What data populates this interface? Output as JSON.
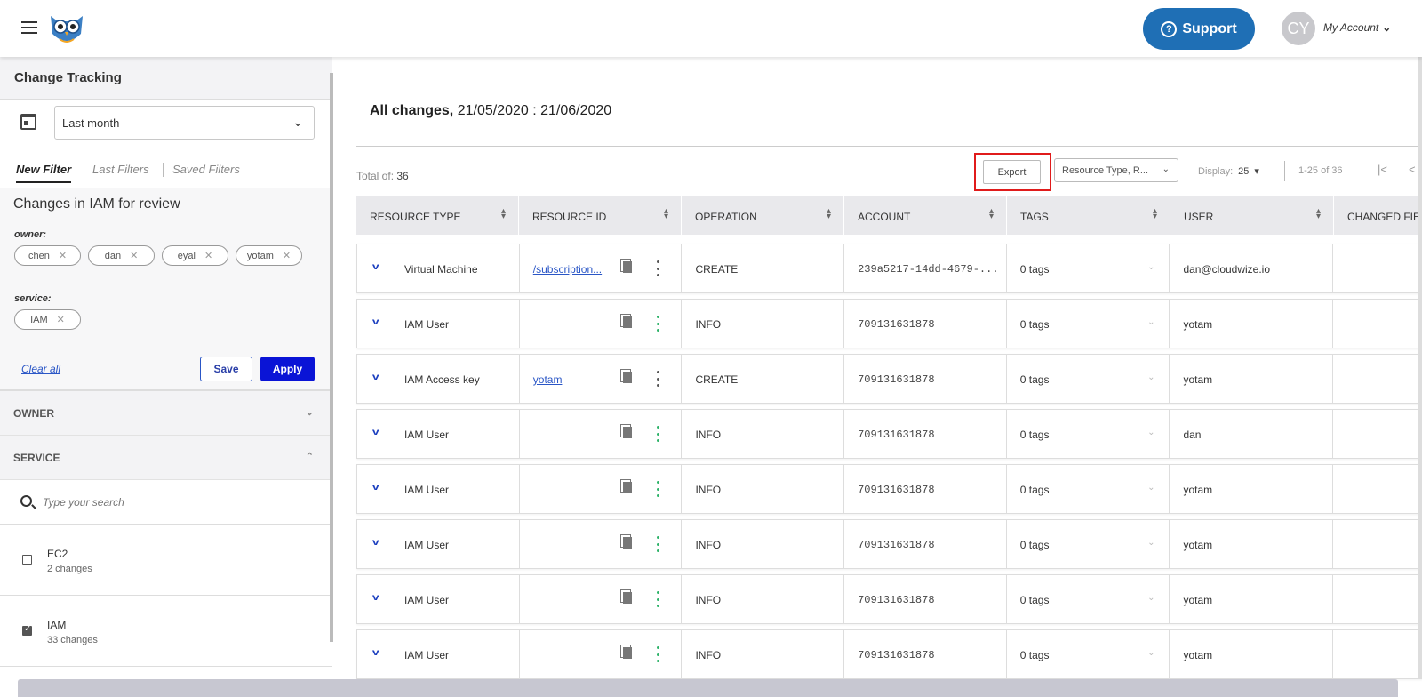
{
  "header": {
    "support_label": "Support",
    "avatar_initials": "CY",
    "account_label": "My Account"
  },
  "sidebar": {
    "title": "Change Tracking",
    "date_range": "Last month",
    "tabs": [
      "New Filter",
      "Last Filters",
      "Saved Filters"
    ],
    "filter_name": "Changes in IAM for review",
    "owner": {
      "label": "owner:",
      "chips": [
        "chen",
        "dan",
        "eyal",
        "yotam"
      ]
    },
    "service": {
      "label": "service:",
      "chips": [
        "IAM"
      ]
    },
    "clear_all": "Clear all",
    "save_label": "Save",
    "apply_label": "Apply",
    "sections": {
      "owner": "OWNER",
      "service": "SERVICE"
    },
    "search_placeholder": "Type your search",
    "services": [
      {
        "name": "EC2",
        "count": "2 changes",
        "checked": false
      },
      {
        "name": "IAM",
        "count": "33 changes",
        "checked": true
      }
    ]
  },
  "main": {
    "title_bold": "All changes,",
    "title_range": "21/05/2020 : 21/06/2020",
    "total_label": "Total of:",
    "total_value": "36",
    "export_label": "Export",
    "columns_select": "Resource Type, R...",
    "display_label": "Display:",
    "display_value": "25",
    "page_range": "1-25 of 36",
    "columns": [
      "RESOURCE TYPE",
      "RESOURCE ID",
      "OPERATION",
      "ACCOUNT",
      "TAGS",
      "USER",
      "CHANGED FIE"
    ],
    "rows": [
      {
        "type": "Virtual Machine",
        "resource_id": "/subscription...",
        "operation": "CREATE",
        "account": "239a5217-14dd-4679-...",
        "tags": "0 tags",
        "user": "dan@cloudwize.io",
        "kebab": "gray"
      },
      {
        "type": "IAM User",
        "resource_id": "",
        "operation": "INFO",
        "account": "709131631878",
        "tags": "0 tags",
        "user": "yotam",
        "kebab": "green"
      },
      {
        "type": "IAM Access key",
        "resource_id": "yotam",
        "operation": "CREATE",
        "account": "709131631878",
        "tags": "0 tags",
        "user": "yotam",
        "kebab": "gray"
      },
      {
        "type": "IAM User",
        "resource_id": "",
        "operation": "INFO",
        "account": "709131631878",
        "tags": "0 tags",
        "user": "dan",
        "kebab": "green"
      },
      {
        "type": "IAM User",
        "resource_id": "",
        "operation": "INFO",
        "account": "709131631878",
        "tags": "0 tags",
        "user": "yotam",
        "kebab": "green"
      },
      {
        "type": "IAM User",
        "resource_id": "",
        "operation": "INFO",
        "account": "709131631878",
        "tags": "0 tags",
        "user": "yotam",
        "kebab": "green"
      },
      {
        "type": "IAM User",
        "resource_id": "",
        "operation": "INFO",
        "account": "709131631878",
        "tags": "0 tags",
        "user": "yotam",
        "kebab": "green"
      },
      {
        "type": "IAM User",
        "resource_id": "",
        "operation": "INFO",
        "account": "709131631878",
        "tags": "0 tags",
        "user": "yotam",
        "kebab": "green"
      }
    ]
  },
  "colors": {
    "primary": "#1f6fb5",
    "apply": "#0a14d6",
    "highlight": "#e01b1b",
    "kebab_green": "#2fb36a"
  }
}
